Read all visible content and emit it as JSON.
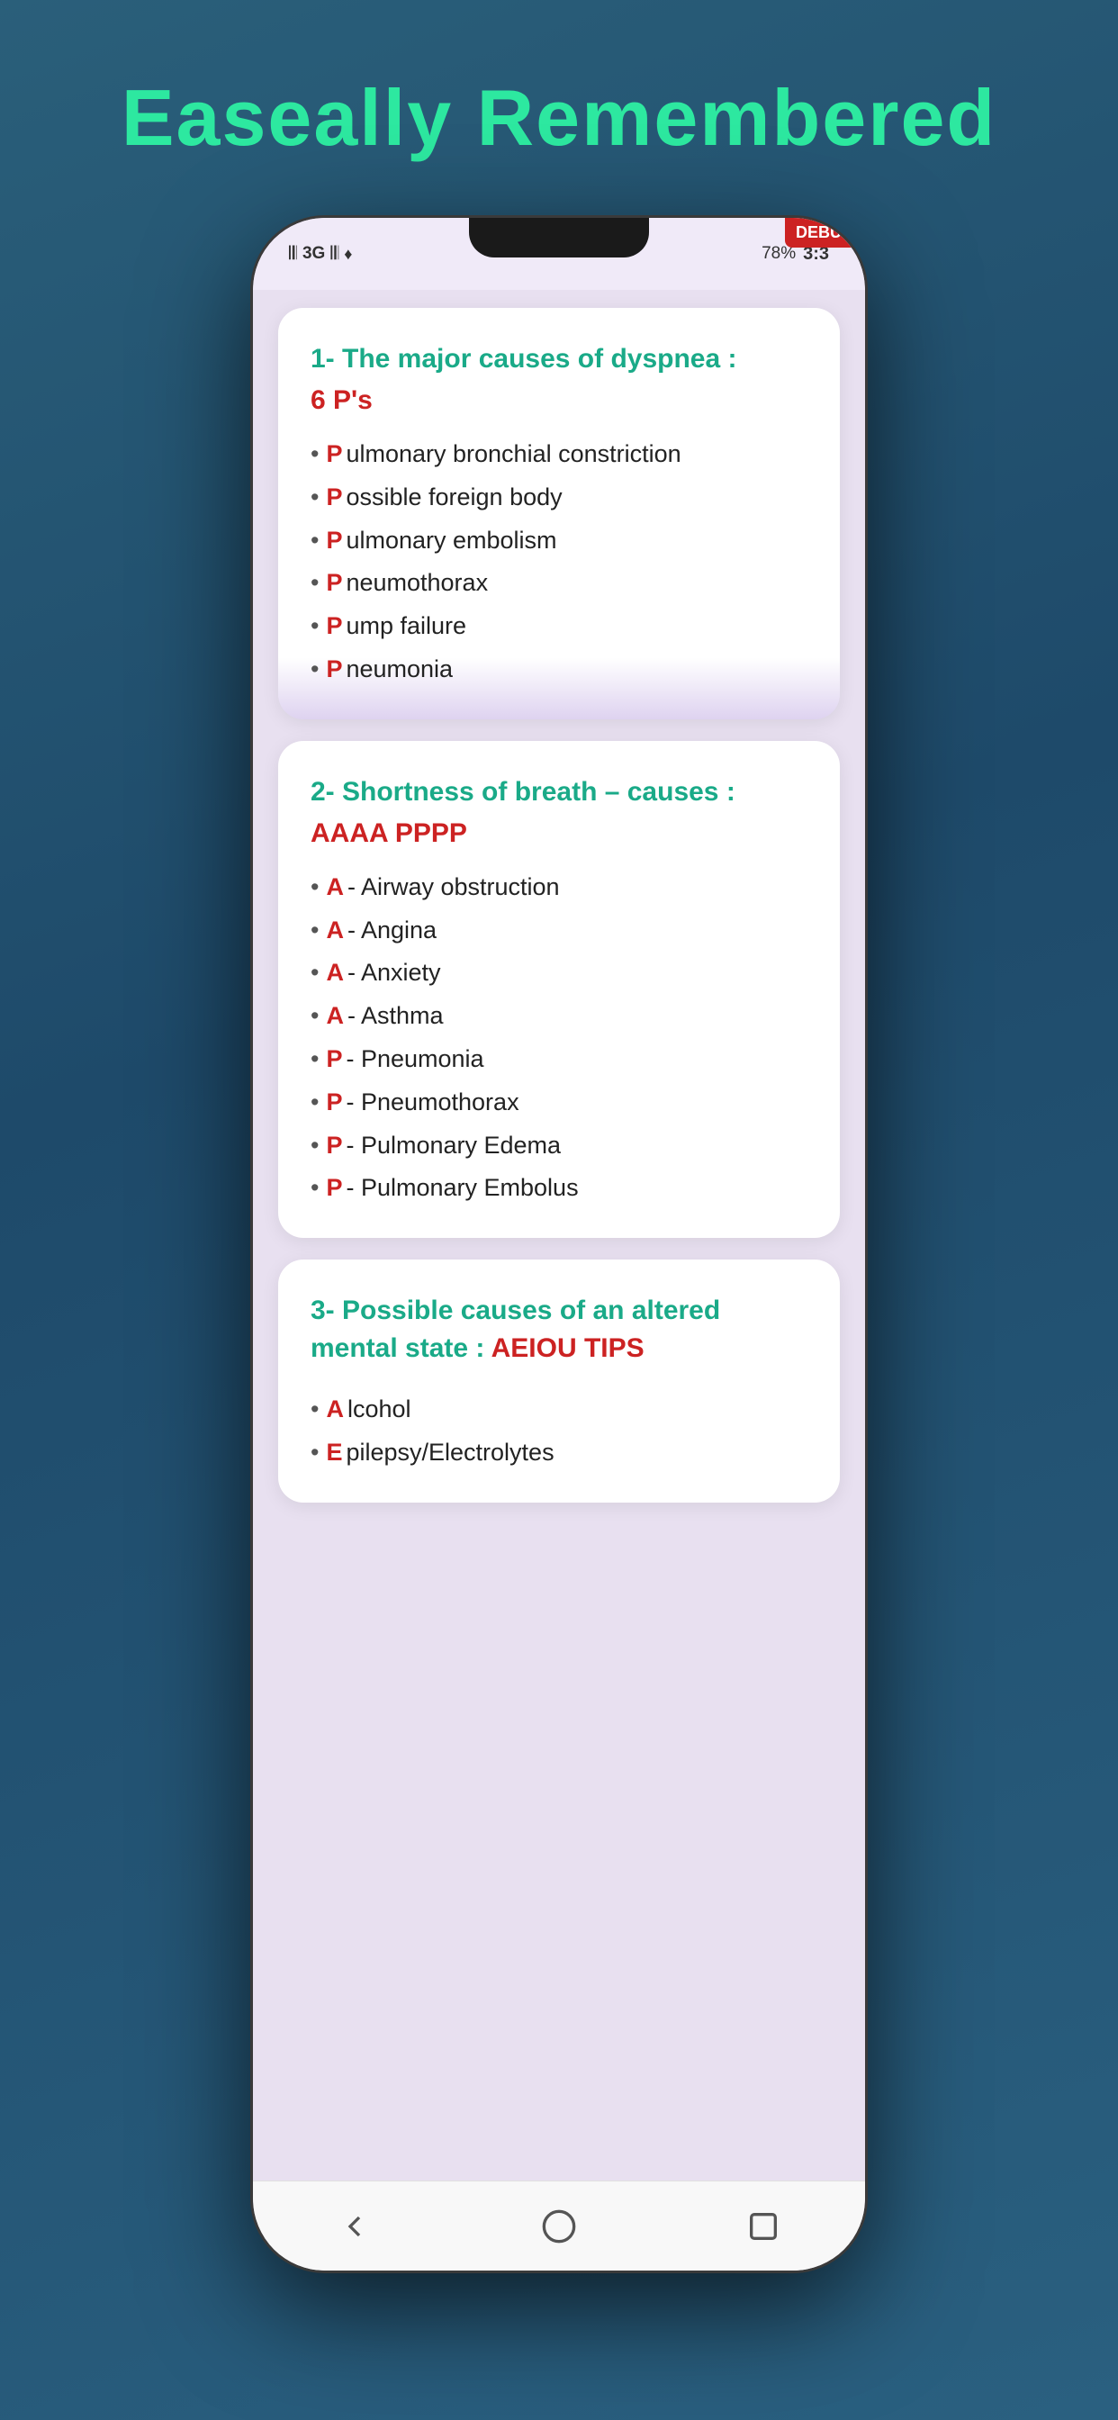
{
  "app": {
    "title": "Easeally Remembered"
  },
  "status_bar": {
    "signal1": "●●●",
    "network": "3G",
    "signal2": "●●●",
    "sound": "♦",
    "battery": "78%",
    "time": "3:3"
  },
  "debug_badge": "DEBUG",
  "cards": [
    {
      "id": "card1",
      "number": "1-",
      "title": "The major causes of dyspnea",
      "title_suffix": " :",
      "mnemonic": "6 P's",
      "items": [
        {
          "letter": "P",
          "rest": "ulmonary bronchial constriction"
        },
        {
          "letter": "P",
          "rest": "ossible foreign body"
        },
        {
          "letter": "P",
          "rest": "ulmonary embolism"
        },
        {
          "letter": "P",
          "rest": "neumothorax"
        },
        {
          "letter": "P",
          "rest": "ump failure"
        },
        {
          "letter": "P",
          "rest": "neumonia"
        }
      ]
    },
    {
      "id": "card2",
      "number": "2-",
      "title": "Shortness of breath – causes",
      "title_suffix": " :",
      "mnemonic": "AAAA PPPP",
      "items": [
        {
          "letter": "A",
          "rest": " - Airway obstruction"
        },
        {
          "letter": "A",
          "rest": " - Angina"
        },
        {
          "letter": "A",
          "rest": " - Anxiety"
        },
        {
          "letter": "A",
          "rest": " - Asthma"
        },
        {
          "letter": "P",
          "rest": " - Pneumonia"
        },
        {
          "letter": "P",
          "rest": " - Pneumothorax"
        },
        {
          "letter": "P",
          "rest": " - Pulmonary Edema"
        },
        {
          "letter": "P",
          "rest": " - Pulmonary Embolus"
        }
      ]
    },
    {
      "id": "card3",
      "number": "3-",
      "title": "Possible causes of an altered mental state",
      "title_suffix": " :",
      "mnemonic": "AEIOU TIPS",
      "items": [
        {
          "letter": "A",
          "rest": "lcohol"
        },
        {
          "letter": "E",
          "rest": "pilepsy/Electrolytes"
        }
      ]
    }
  ],
  "nav": {
    "back_label": "back",
    "home_label": "home",
    "square_label": "recent"
  }
}
